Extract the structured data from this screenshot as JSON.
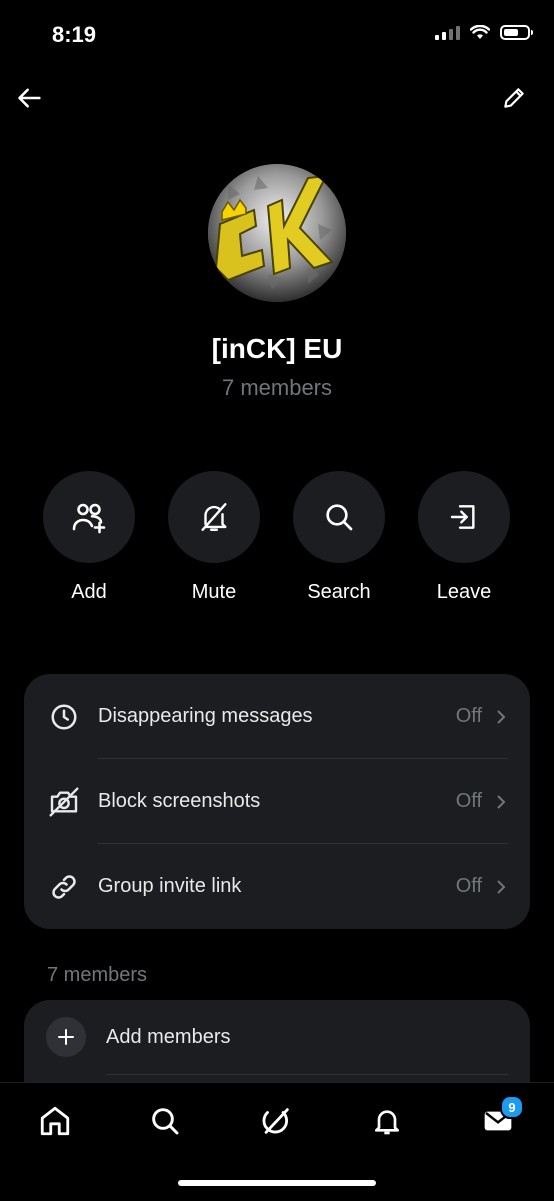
{
  "status_bar": {
    "time": "8:19",
    "battery_level": 0.55
  },
  "header": {
    "back_icon": "arrow-left-icon",
    "edit_icon": "pencil-icon"
  },
  "group": {
    "name": "[inCK] EU",
    "member_count": "7 members",
    "avatar_logo_text": "CK"
  },
  "actions": [
    {
      "label": "Add",
      "icon": "add-people-icon"
    },
    {
      "label": "Mute",
      "icon": "bell-off-icon"
    },
    {
      "label": "Search",
      "icon": "search-icon"
    },
    {
      "label": "Leave",
      "icon": "leave-icon"
    }
  ],
  "settings": [
    {
      "label": "Disappearing messages",
      "value": "Off",
      "icon": "clock-icon"
    },
    {
      "label": "Block screenshots",
      "value": "Off",
      "icon": "camera-off-icon"
    },
    {
      "label": "Group invite link",
      "value": "Off",
      "icon": "link-icon"
    }
  ],
  "members_section": {
    "title": "7 members",
    "add_label": "Add members"
  },
  "bottom_nav": {
    "items": [
      "home-icon",
      "search-icon",
      "grok-icon",
      "bell-icon",
      "mail-icon"
    ],
    "messages_badge": "9"
  },
  "colors": {
    "background": "#000000",
    "card": "#1c1d20",
    "accent": "#1d9bf0",
    "secondary_text": "#71767b"
  }
}
